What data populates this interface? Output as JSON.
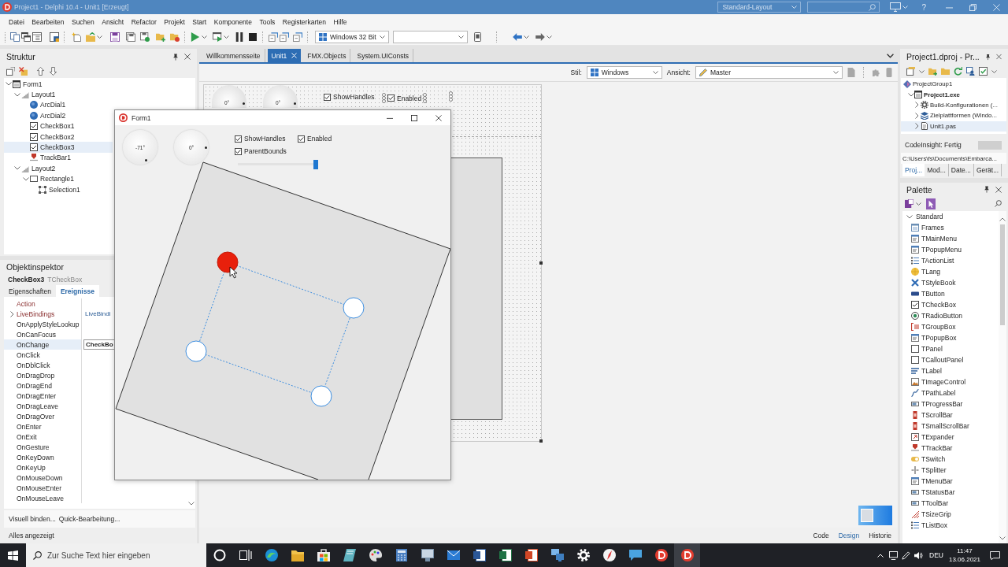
{
  "window": {
    "title": "Project1 - Delphi 10.4 - Unit1 [Erzeugt]",
    "layout": "Standard-Layout",
    "help": "?"
  },
  "menu": [
    "Datei",
    "Bearbeiten",
    "Suchen",
    "Ansicht",
    "Refactor",
    "Projekt",
    "Start",
    "Komponente",
    "Tools",
    "Registerkarten",
    "Hilfe"
  ],
  "toolbar": {
    "platform": "Windows 32 Bit"
  },
  "structure": {
    "title": "Struktur",
    "tree": [
      {
        "label": "Form1",
        "kind": "form",
        "expanded": true,
        "selected": false,
        "children": [
          {
            "label": "Layout1",
            "kind": "layout",
            "expanded": true,
            "selected": false,
            "children": [
              {
                "label": "ArcDial1",
                "kind": "dial",
                "selected": false
              },
              {
                "label": "ArcDial2",
                "kind": "dial",
                "selected": false
              },
              {
                "label": "CheckBox1",
                "kind": "checkbox",
                "selected": false
              },
              {
                "label": "CheckBox2",
                "kind": "checkbox",
                "selected": false
              },
              {
                "label": "CheckBox3",
                "kind": "checkbox",
                "selected": true
              },
              {
                "label": "TrackBar1",
                "kind": "trackbar",
                "selected": false
              }
            ]
          },
          {
            "label": "Layout2",
            "kind": "layout",
            "expanded": true,
            "selected": false,
            "children": [
              {
                "label": "Rectangle1",
                "kind": "rectangle",
                "expanded": true,
                "selected": false,
                "children": [
                  {
                    "label": "Selection1",
                    "kind": "selection",
                    "selected": false
                  }
                ]
              }
            ]
          }
        ]
      }
    ]
  },
  "inspector": {
    "title": "Objektinspektor",
    "object": "CheckBox3",
    "type": "TCheckBox",
    "tabs": [
      {
        "label": "Eigenschaften",
        "selected": false
      },
      {
        "label": "Ereignisse",
        "selected": true
      }
    ],
    "rows": [
      {
        "name": "Action",
        "kind": "reference",
        "selected": false
      },
      {
        "name": "LiveBindings",
        "kind": "group",
        "value": "LiveBindi",
        "selected": false
      },
      {
        "name": "OnApplyStyleLookup",
        "kind": "event",
        "selected": false
      },
      {
        "name": "OnCanFocus",
        "kind": "event",
        "selected": false
      },
      {
        "name": "OnChange",
        "kind": "event",
        "value": "CheckBo",
        "selected": true
      },
      {
        "name": "OnClick",
        "kind": "event",
        "selected": false
      },
      {
        "name": "OnDblClick",
        "kind": "event",
        "selected": false
      },
      {
        "name": "OnDragDrop",
        "kind": "event",
        "selected": false
      },
      {
        "name": "OnDragEnd",
        "kind": "event",
        "selected": false
      },
      {
        "name": "OnDragEnter",
        "kind": "event",
        "selected": false
      },
      {
        "name": "OnDragLeave",
        "kind": "event",
        "selected": false
      },
      {
        "name": "OnDragOver",
        "kind": "event",
        "selected": false
      },
      {
        "name": "OnEnter",
        "kind": "event",
        "selected": false
      },
      {
        "name": "OnExit",
        "kind": "event",
        "selected": false
      },
      {
        "name": "OnGesture",
        "kind": "event",
        "selected": false
      },
      {
        "name": "OnKeyDown",
        "kind": "event",
        "selected": false
      },
      {
        "name": "OnKeyUp",
        "kind": "event",
        "selected": false
      },
      {
        "name": "OnMouseDown",
        "kind": "event",
        "selected": false
      },
      {
        "name": "OnMouseEnter",
        "kind": "event",
        "selected": false
      },
      {
        "name": "OnMouseLeave",
        "kind": "event",
        "selected": false
      }
    ],
    "links": [
      "Visuell binden...",
      "Quick-Bearbeitung..."
    ],
    "status": "Alles angezeigt"
  },
  "editor": {
    "tabs": [
      {
        "label": "Willkommensseite",
        "selected": false
      },
      {
        "label": "Unit1",
        "selected": true
      },
      {
        "label": "FMX.Objects",
        "selected": false
      },
      {
        "label": "System.UIConsts",
        "selected": false
      }
    ],
    "style_label": "Stil:",
    "style": "Windows",
    "view_label": "Ansicht:",
    "view": "Master",
    "design": {
      "dials": [
        "0°",
        "0°"
      ],
      "checkboxes": [
        {
          "label": "ShowHandles",
          "checked": true,
          "selected": false
        },
        {
          "label": "Enabled",
          "checked": true,
          "selected": true
        }
      ]
    },
    "views": [
      {
        "label": "Code",
        "selected": false
      },
      {
        "label": "Design",
        "selected": true
      },
      {
        "label": "Historie",
        "selected": false
      }
    ]
  },
  "form_window": {
    "title": "Form1",
    "dials": [
      "-71°",
      "0°"
    ],
    "checkboxes": [
      {
        "label": "ShowHandles",
        "checked": true
      },
      {
        "label": "Enabled",
        "checked": true
      },
      {
        "label": "ParentBounds",
        "checked": true
      }
    ],
    "trackbar": {
      "level": 0.97
    }
  },
  "project": {
    "title": "Project1.dproj - Pr...",
    "tree": [
      {
        "label": "ProjectGroup1",
        "kind": "group",
        "active": false,
        "selected": false,
        "children": [
          {
            "label": "Project1.exe",
            "kind": "project",
            "active": true,
            "expanded": true,
            "selected": false,
            "children": [
              {
                "label": "Build-Konfigurationen (...",
                "kind": "build",
                "active": false,
                "expanded": false,
                "selected": false
              },
              {
                "label": "Zielplattformen (Windo...",
                "kind": "platforms",
                "active": false,
                "expanded": false,
                "selected": false
              },
              {
                "label": "Unit1.pas",
                "kind": "unit",
                "active": false,
                "expanded": false,
                "selected": true
              }
            ]
          }
        ]
      }
    ],
    "status": "CodeInsight: Fertig",
    "path": "C:\\Users\\fs\\Documents\\Embarca...",
    "tabs": [
      {
        "label": "Proj...",
        "selected": true
      },
      {
        "label": "Mod...",
        "selected": false
      },
      {
        "label": "Date...",
        "selected": false
      },
      {
        "label": "Gerät...",
        "selected": false
      }
    ]
  },
  "palette": {
    "title": "Palette",
    "category": {
      "label": "Standard",
      "expanded": true
    },
    "items": [
      "Frames",
      "TMainMenu",
      "TPopupMenu",
      "TActionList",
      "TLang",
      "TStyleBook",
      "TButton",
      "TCheckBox",
      "TRadioButton",
      "TGroupBox",
      "TPopupBox",
      "TPanel",
      "TCalloutPanel",
      "TLabel",
      "TImageControl",
      "TPathLabel",
      "TProgressBar",
      "TScrollBar",
      "TSmallScrollBar",
      "TExpander",
      "TTrackBar",
      "TSwitch",
      "TSplitter",
      "TMenuBar",
      "TStatusBar",
      "TToolBar",
      "TSizeGrip",
      "TListBox"
    ]
  },
  "taskbar": {
    "search_placeholder": "Zur Suche Text hier eingeben",
    "apps": [
      {
        "selected": false
      },
      {
        "selected": false
      },
      {
        "selected": false
      },
      {
        "selected": false
      },
      {
        "selected": false
      },
      {
        "selected": false
      },
      {
        "selected": false
      },
      {
        "selected": false
      },
      {
        "selected": false
      },
      {
        "selected": false
      },
      {
        "selected": false
      },
      {
        "selected": false
      },
      {
        "selected": false
      },
      {
        "selected": false
      },
      {
        "selected": false
      },
      {
        "selected": false
      },
      {
        "selected": true
      }
    ],
    "language": "DEU",
    "time": "11:47",
    "date": "13.06.2021"
  }
}
